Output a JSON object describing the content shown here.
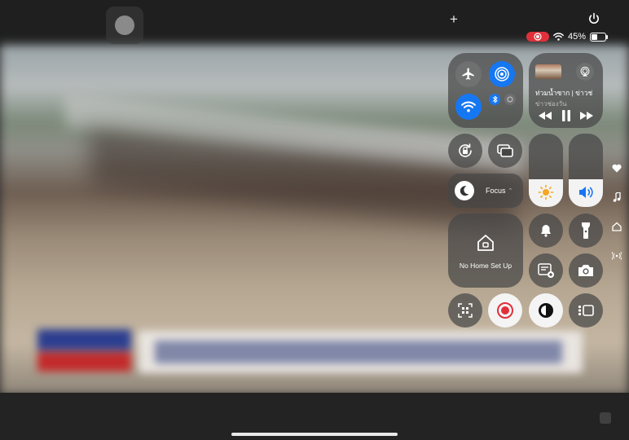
{
  "background": {
    "description_shown": "blurred flood news video"
  },
  "status_bar": {
    "battery_percent": "45%",
    "recording": true,
    "icons": [
      "add-icon",
      "power-icon",
      "screen-recording-icon",
      "wifi-icon",
      "battery-icon"
    ]
  },
  "control_center": {
    "connectivity": {
      "airplane_mode": false,
      "airdrop": true,
      "wifi": true,
      "bluetooth": true
    },
    "now_playing": {
      "title": "ท่วมน้ำซาก | ข่าวช่",
      "subtitle": "ข่าวช่องวัน",
      "controls": [
        "rewind-icon",
        "pause-icon",
        "fast-forward-icon"
      ]
    },
    "brightness_level": 0.38,
    "volume_level": 0.38,
    "focus": {
      "label": "Focus",
      "chevron": "⌃"
    },
    "home": {
      "label": "No Home Set Up"
    },
    "accent_blue": "#1677f2",
    "record_red": "#e0313b"
  },
  "side_icons": [
    "heart-icon",
    "music-note-icon",
    "home-small-icon",
    "signal-icon"
  ]
}
